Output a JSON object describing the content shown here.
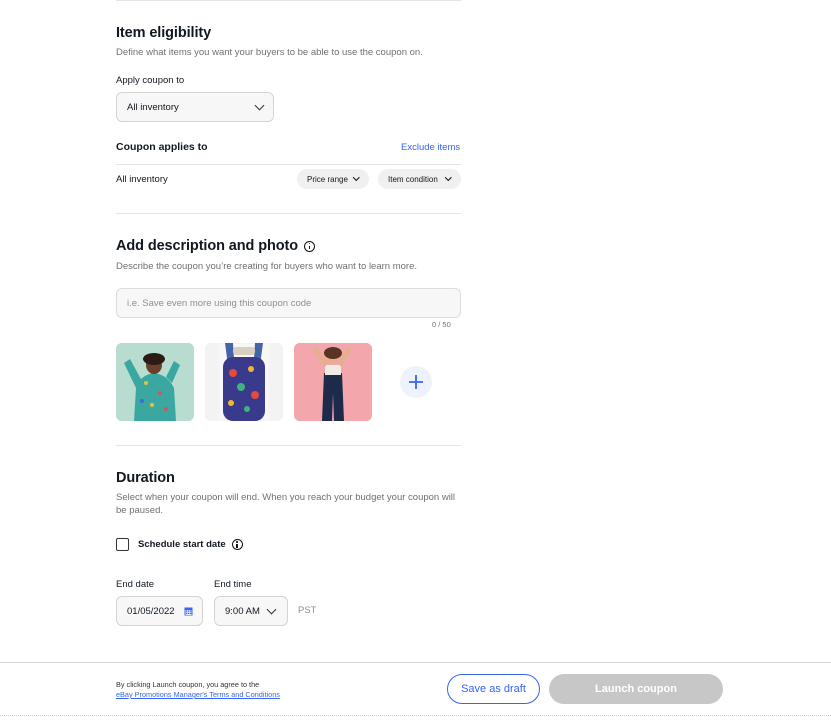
{
  "eligibility": {
    "title": "Item eligibility",
    "description": "Define what items you want your buyers to be able to use the coupon on.",
    "apply_label": "Apply coupon to",
    "apply_value": "All inventory",
    "applies_to_label": "Coupon applies to",
    "exclude_link": "Exclude items",
    "applies_value": "All inventory",
    "filter_price": "Price range",
    "filter_condition": "Item condition"
  },
  "description_section": {
    "title": "Add description and photo",
    "subtitle": "Describe the coupon you’re creating for buyers who want to learn more.",
    "placeholder": "i.e. Save even more using this coupon code",
    "char_count": "0 / 50"
  },
  "duration": {
    "title": "Duration",
    "subtitle": "Select when your coupon will end. When you reach your budget your coupon will be paused.",
    "schedule_label": "Schedule start date",
    "end_date_label": "End date",
    "end_date_value": "01/05/2022",
    "end_time_label": "End time",
    "end_time_value": "9:00 AM",
    "timezone": "PST"
  },
  "footer": {
    "terms_line1": "By clicking Launch coupon, you agree to the",
    "terms_link": "eBay Promotions Manager's Terms and Conditions",
    "save_draft": "Save as draft",
    "launch": "Launch coupon"
  },
  "colors": {
    "accent": "#3665f3",
    "disabled": "#c7c7c7"
  }
}
